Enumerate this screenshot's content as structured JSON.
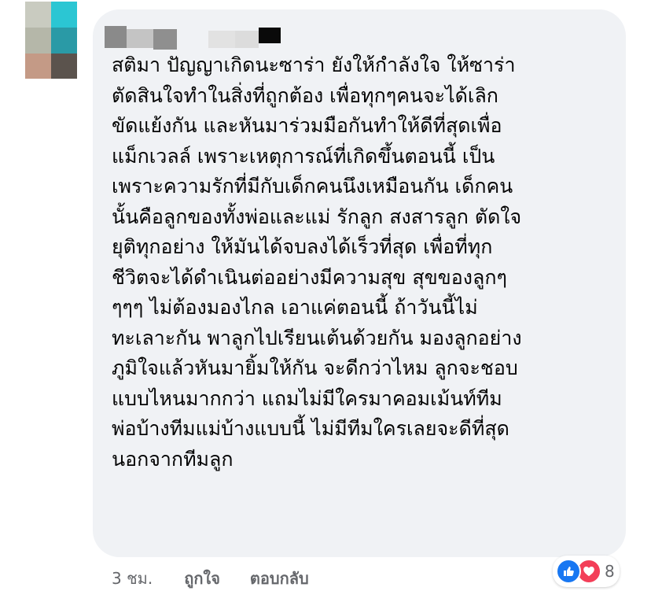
{
  "comment": {
    "lines": [
      "สติมา ปัญญาเกิดนะซาร่า ยังให้กำลังใจ ให้ซาร่า",
      "ตัดสินใจทำในสิ่งที่ถูกต้อง เพื่อทุกๆคนจะได้เลิก",
      "ขัดแย้งกัน และหันมาร่วมมือกันทำให้ดีที่สุดเพื่อ",
      "แม็กเวลล์ เพราะเหตุการณ์ที่เกิดขึ้นตอนนี้ เป็น",
      "เพราะความรักที่มีกับเด็กคนนึงเหมือนกัน เด็กคน",
      "นั้นคือลูกของทั้งพ่อและแม่ รักลูก สงสารลูก ตัดใจ",
      "ยุติทุกอย่าง ให้มันได้จบลงได้เร็วที่สุด เพื่อที่ทุก",
      "ชีวิตจะได้ดำเนินต่ออย่างมีความสุข สุขของลูกๆ",
      "ๆๆๆ ไม่ต้องมองไกล เอาแค่ตอนนี้ ถ้าวันนี้ไม่",
      "ทะเลาะกัน พาลูกไปเรียนเต้นด้วยกัน มองลูกอย่าง",
      "ภูมิใจแล้วหันมายิ้มให้กัน จะดีกว่าไหม ลูกจะชอบ",
      "แบบไหนมากกว่า แถมไม่มีใครมาคอมเม้นท์ทีม",
      "พ่อบ้างทีมแม่บ้างแบบนี้ ไม่มีทีมใครเลยจะดีที่สุด",
      "นอกจากทีมลูก"
    ]
  },
  "actions": {
    "time": "3 ชม.",
    "like_label": "ถูกใจ",
    "reply_label": "ตอบกลับ"
  },
  "reactions": {
    "icons": [
      "like-icon",
      "love-icon"
    ],
    "count": "8"
  },
  "colors": {
    "bubble": "#f0f2f5",
    "text": "#050505",
    "secondary_text": "#65676b",
    "like_blue": "#1877f2",
    "love_red": "#f33e58"
  }
}
